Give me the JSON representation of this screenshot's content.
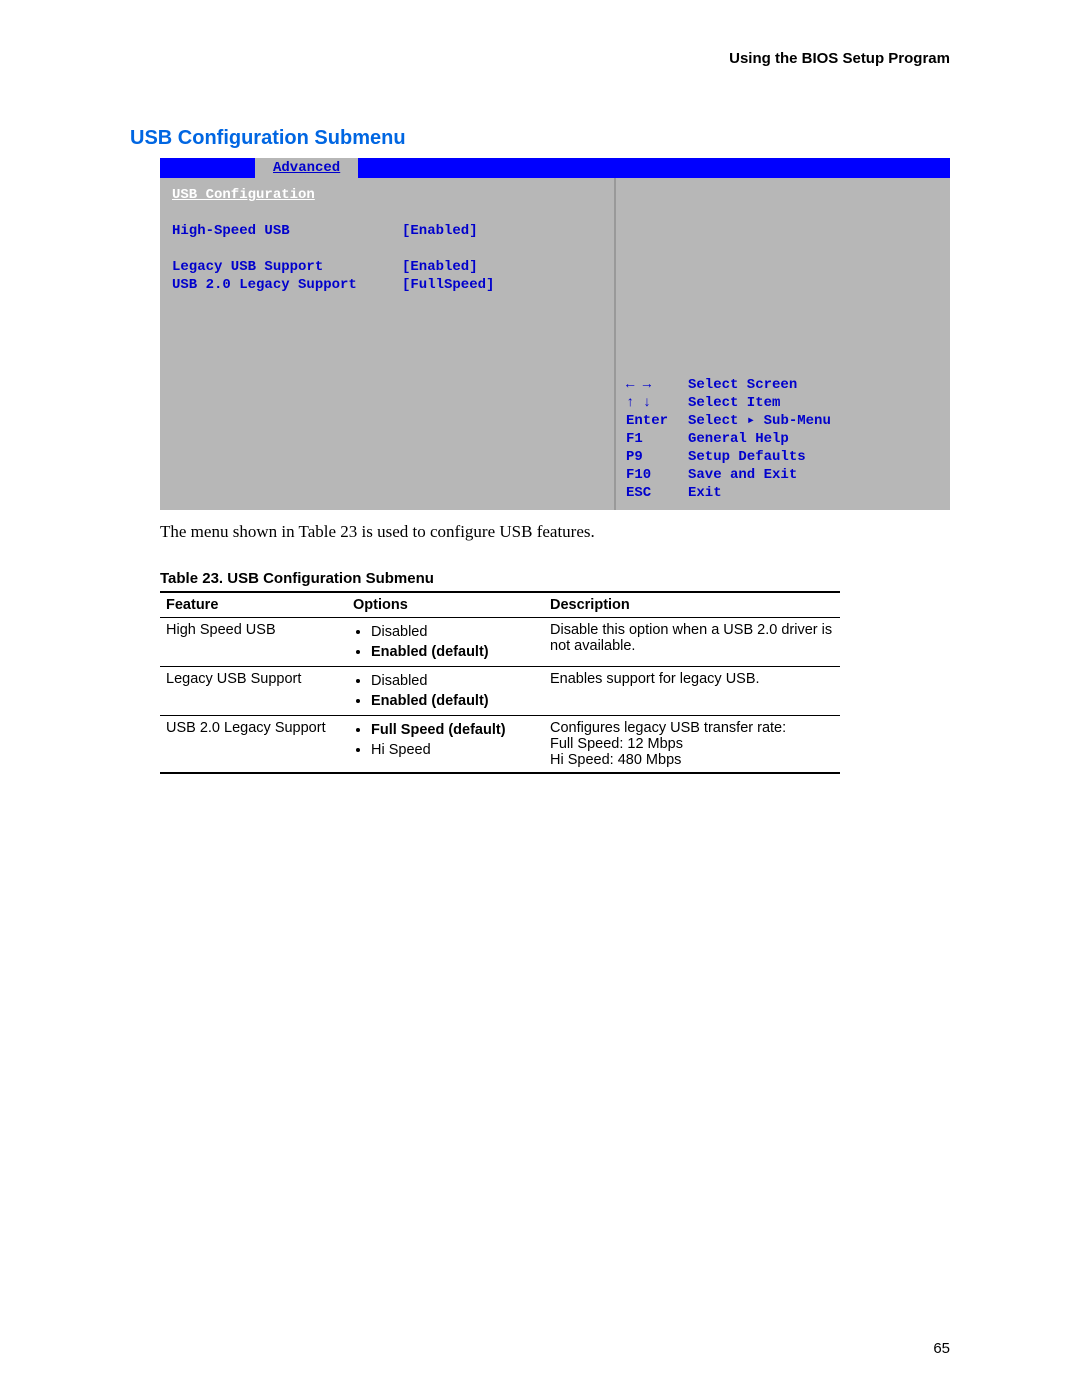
{
  "header_right": "Using the BIOS Setup Program",
  "section_title": "USB Configuration Submenu",
  "bios": {
    "tab": "Advanced",
    "title": "USB Configuration",
    "items": [
      {
        "label": "High-Speed USB",
        "value": "[Enabled]"
      },
      {
        "label": "Legacy USB Support",
        "value": "[Enabled]"
      },
      {
        "label": "USB 2.0 Legacy Support",
        "value": "[FullSpeed]"
      }
    ],
    "help": [
      {
        "key": "← →",
        "desc": "Select Screen"
      },
      {
        "key": "↑ ↓",
        "desc": "Select Item"
      },
      {
        "key": "Enter",
        "desc": "Select ▸ Sub-Menu"
      },
      {
        "key": "F1",
        "desc": "General Help"
      },
      {
        "key": "P9",
        "desc": "Setup Defaults"
      },
      {
        "key": "F10",
        "desc": "Save and Exit"
      },
      {
        "key": "ESC",
        "desc": "Exit"
      }
    ]
  },
  "caption": "The menu shown in Table 23 is used to configure USB features.",
  "table_title": "Table 23.    USB Configuration Submenu",
  "table": {
    "headers": {
      "feature": "Feature",
      "options": "Options",
      "description": "Description"
    },
    "rows": [
      {
        "feature": "High Speed USB",
        "options": [
          {
            "text": "Disabled",
            "bold": false
          },
          {
            "text": "Enabled (default)",
            "bold": true
          }
        ],
        "description": "Disable this option when a USB 2.0 driver is not available."
      },
      {
        "feature": "Legacy USB Support",
        "options": [
          {
            "text": "Disabled",
            "bold": false
          },
          {
            "text": "Enabled (default)",
            "bold": true
          }
        ],
        "description": "Enables support for legacy USB."
      },
      {
        "feature": "USB 2.0 Legacy Support",
        "options": [
          {
            "text": "Full Speed (default)",
            "bold": true
          },
          {
            "text": "Hi Speed",
            "bold": false
          }
        ],
        "description": "Configures legacy USB transfer rate:\nFull Speed:  12 Mbps\nHi Speed:  480 Mbps"
      }
    ]
  },
  "page_number": "65"
}
